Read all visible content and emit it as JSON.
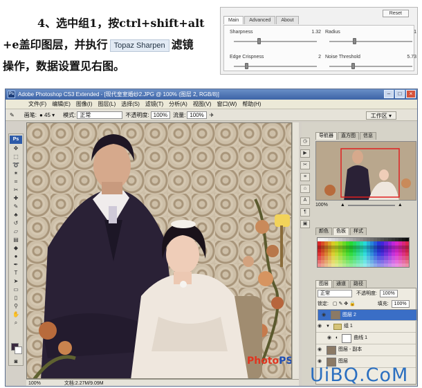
{
  "tutorial": {
    "line1": "4、选中组1，按ctrl+shift+alt",
    "line2_a": "+e盖印图层，并执行",
    "plugin_chip": "Topaz Sharpen",
    "line2_b": "滤镜",
    "line3": "操作，数据设置见右图。"
  },
  "topaz": {
    "tabs": [
      "Main",
      "Advanced",
      "About"
    ],
    "active_tab": "Main",
    "reset_label": "Reset",
    "params": [
      {
        "name": "Sharpness",
        "value": "1.32",
        "level": 0.3
      },
      {
        "name": "Radius",
        "value": "1",
        "level": 0.3
      },
      {
        "name": "Edge Crispness",
        "value": "2",
        "level": 0.15
      },
      {
        "name": "Noise Threshold",
        "value": "5.73",
        "level": 0.28
      }
    ]
  },
  "photoshop": {
    "title": "Adobe Photoshop CS3 Extended - [现代皇室婚纱2.JPG @ 100% (图层 2, RGB/8)]",
    "menu": [
      "文件(F)",
      "编辑(E)",
      "图像(I)",
      "图层(L)",
      "选择(S)",
      "滤镜(T)",
      "分析(A)",
      "视图(V)",
      "窗口(W)",
      "帮助(H)"
    ],
    "options": {
      "brush_label": "画笔:",
      "brush_size": "45",
      "mode_label": "模式:",
      "mode_value": "正常",
      "opacity_label": "不透明度:",
      "opacity_value": "100%",
      "flow_label": "流量:",
      "flow_value": "100%",
      "workspace": "工作区"
    },
    "status": {
      "zoom": "100%",
      "doc": "文档:2.27M/9.09M"
    },
    "toolbox_logo": "Ps",
    "colors": {
      "foreground": "#3a2a40",
      "background": "#ffffff"
    }
  },
  "panels": {
    "navigator_tabs": [
      "导航器",
      "直方图",
      "信息"
    ],
    "navigator_zoom": "100%",
    "color_tabs": [
      "颜色",
      "色板",
      "样式"
    ],
    "layers_tabs": [
      "图层",
      "通道",
      "路径"
    ],
    "blend_mode": "正常",
    "opacity_label": "不透明度:",
    "opacity_value": "100%",
    "lock_label": "锁定:",
    "fill_label": "填充:",
    "fill_value": "100%",
    "layers": [
      {
        "name": "图层 2",
        "selected": true,
        "kind": "photo"
      },
      {
        "name": "组 1",
        "selected": false,
        "kind": "folder"
      },
      {
        "name": "曲线 1",
        "selected": false,
        "kind": "adjust"
      },
      {
        "name": "图层 - 副本",
        "selected": false,
        "kind": "photo"
      },
      {
        "name": "图层",
        "selected": false,
        "kind": "photo"
      }
    ]
  },
  "watermarks": {
    "site": "UiBQ.CoM",
    "photops_a": "Photo",
    "photops_b": "PS"
  }
}
